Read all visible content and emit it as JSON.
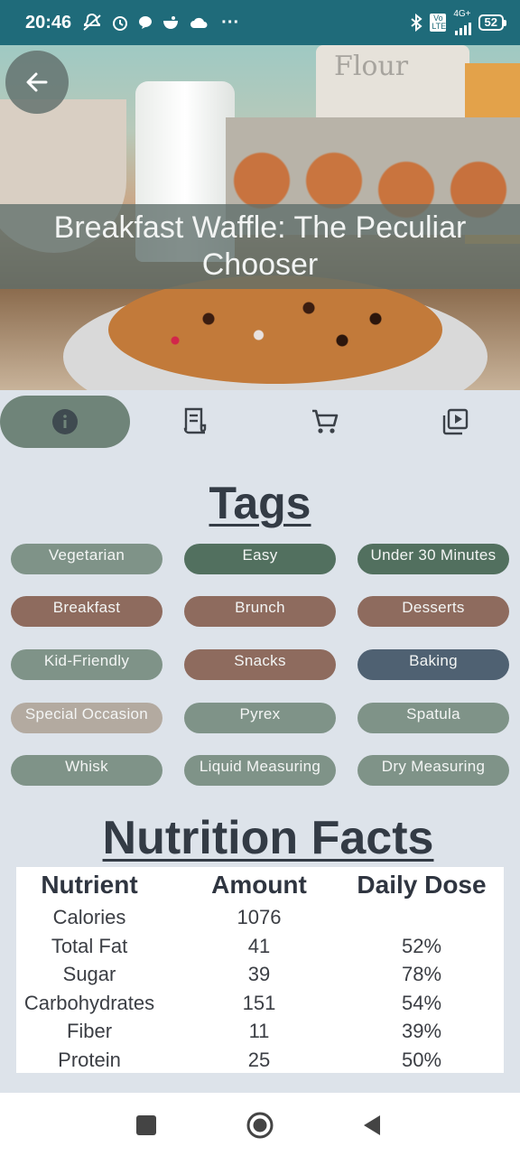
{
  "status_bar": {
    "time": "20:46",
    "battery": "52",
    "network": "4G+",
    "volte": "Vo LTE",
    "more": "···"
  },
  "recipe": {
    "title": "Breakfast Waffle: The Peculiar Chooser",
    "hero_text": "Flour"
  },
  "tabs": [
    {
      "icon": "info-icon",
      "active": true
    },
    {
      "icon": "receipt-icon",
      "active": false
    },
    {
      "icon": "shopping-cart-icon",
      "active": false
    },
    {
      "icon": "video-library-icon",
      "active": false
    }
  ],
  "tags_section": {
    "title": "Tags",
    "items": [
      {
        "label": "Vegetarian",
        "color": "#7f9388"
      },
      {
        "label": "Easy",
        "color": "#52705f"
      },
      {
        "label": "Under 30 Minutes",
        "color": "#52705f"
      },
      {
        "label": "Breakfast",
        "color": "#8e6b5e"
      },
      {
        "label": "Brunch",
        "color": "#8e6b5e"
      },
      {
        "label": "Desserts",
        "color": "#8e6b5e"
      },
      {
        "label": "Kid-Friendly",
        "color": "#7f9388"
      },
      {
        "label": "Snacks",
        "color": "#8e6b5e"
      },
      {
        "label": "Baking",
        "color": "#4f6172"
      },
      {
        "label": "Special Occasion",
        "color": "#b3aaa0"
      },
      {
        "label": "Pyrex",
        "color": "#7f9388"
      },
      {
        "label": "Spatula",
        "color": "#7f9388"
      },
      {
        "label": "Whisk",
        "color": "#7f9388"
      },
      {
        "label": "Liquid Measuring",
        "color": "#7f9388"
      },
      {
        "label": "Dry Measuring",
        "color": "#7f9388"
      }
    ]
  },
  "nutrition": {
    "title": "Nutrition Facts",
    "headers": [
      "Nutrient",
      "Amount",
      "Daily Dose"
    ],
    "rows": [
      {
        "nutrient": "Calories",
        "amount": "1076",
        "daily": ""
      },
      {
        "nutrient": "Total Fat",
        "amount": "41",
        "daily": "52%"
      },
      {
        "nutrient": "Sugar",
        "amount": "39",
        "daily": "78%"
      },
      {
        "nutrient": "Carbohydrates",
        "amount": "151",
        "daily": "54%"
      },
      {
        "nutrient": "Fiber",
        "amount": "11",
        "daily": "39%"
      },
      {
        "nutrient": "Protein",
        "amount": "25",
        "daily": "50%"
      }
    ]
  },
  "nav_bar": {
    "buttons": [
      "recent-apps-icon",
      "home-icon",
      "back-triangle-icon"
    ]
  }
}
